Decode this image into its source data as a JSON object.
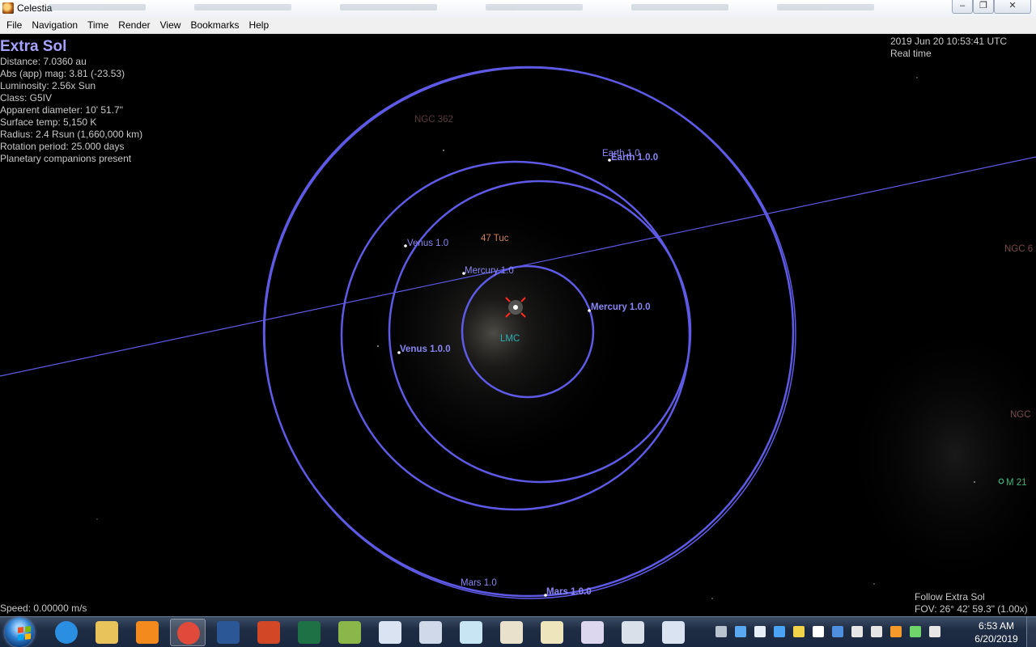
{
  "window": {
    "title": "Celestia",
    "buttons": {
      "minimize": "–",
      "maximize": "❐",
      "close": "✕"
    }
  },
  "menu": [
    "File",
    "Navigation",
    "Time",
    "Render",
    "View",
    "Bookmarks",
    "Help"
  ],
  "info": {
    "name": "Extra Sol",
    "lines": [
      "Distance: 7.0360 au",
      "Abs (app) mag: 3.81 (-23.53)",
      "Luminosity: 2.56x Sun",
      "Class: G5IV",
      "Apparent diameter: 10' 51.7\"",
      "Surface temp: 5,150 K",
      "Radius: 2.4 Rsun  (1,660,000 km)",
      "Rotation period: 25.000 days",
      "Planetary companions present"
    ]
  },
  "time": {
    "datetime": "2019 Jun 20 10:53:41 UTC",
    "mode": "Real time"
  },
  "status": {
    "speed": "Speed: 0.00000 m/s",
    "follow": "Follow Extra Sol",
    "fov": "FOV: 26° 42' 59.3\" (1.00x)"
  },
  "labels": {
    "ngc362": "NGC 362",
    "earth_a": "Earth 1.0",
    "earth_b": "Earth 1.0.0",
    "venus_a": "Venus 1.0",
    "venus_b": "Venus 1.0.0",
    "tuc47": "47 Tuc",
    "mercury_a": "Mercury 1.0",
    "mercury_b": "Mercury 1.0.0",
    "lmc": "LMC",
    "mars_a": "Mars 1.0",
    "mars_b": "Mars 1.0.0",
    "ngc6_right": "NGC 6",
    "ngc_right": "NGC",
    "m21": "M 21"
  },
  "taskbar": {
    "clock_time": "6:53 AM",
    "clock_date": "6/20/2019",
    "apps": [
      {
        "name": "internet-explorer-icon",
        "color": "#2a8fe0"
      },
      {
        "name": "file-explorer-icon",
        "color": "#e8c35a"
      },
      {
        "name": "media-player-icon",
        "color": "#f28a1e"
      },
      {
        "name": "chrome-icon",
        "color": "#e04a3a"
      },
      {
        "name": "word-icon",
        "color": "#2b5797"
      },
      {
        "name": "powerpoint-icon",
        "color": "#d24726"
      },
      {
        "name": "excel-icon",
        "color": "#1e7145"
      },
      {
        "name": "publisher-icon",
        "color": "#8ab64a"
      },
      {
        "name": "word-document-icon",
        "color": "#d9e3f2"
      },
      {
        "name": "document-icon-2",
        "color": "#cfd9ea"
      },
      {
        "name": "document-icon-3",
        "color": "#c7e5f2"
      },
      {
        "name": "document-icon-4",
        "color": "#e9e1cc"
      },
      {
        "name": "document-icon-5",
        "color": "#efe5bd"
      },
      {
        "name": "document-icon-6",
        "color": "#dcd7ef"
      },
      {
        "name": "clock-document-icon",
        "color": "#d8e0ea"
      },
      {
        "name": "word-document-icon-2",
        "color": "#d9e3f2"
      }
    ],
    "tray": [
      {
        "name": "tray-app-icon",
        "color": "#b9c2cf"
      },
      {
        "name": "onedrive-icon",
        "color": "#5aa9f0"
      },
      {
        "name": "cloud-icon",
        "color": "#e6eef8"
      },
      {
        "name": "dropbox-icon",
        "color": "#4aa3f5"
      },
      {
        "name": "security-icon",
        "color": "#f2d44a"
      },
      {
        "name": "flag-icon",
        "color": "#ffffff"
      },
      {
        "name": "network-adapter-icon",
        "color": "#4f8fe0"
      },
      {
        "name": "volume-icon",
        "color": "#e6e6e6"
      },
      {
        "name": "signal-icon",
        "color": "#e6e6e6"
      },
      {
        "name": "sublime-icon",
        "color": "#f39a2a"
      },
      {
        "name": "battery-icon",
        "color": "#6fd46a"
      },
      {
        "name": "update-icon",
        "color": "#e6e6e6"
      }
    ]
  },
  "colors": {
    "orbit": "#5f5ae6",
    "info_title": "#a6a3ff",
    "taskbar": "#1f2d44"
  }
}
